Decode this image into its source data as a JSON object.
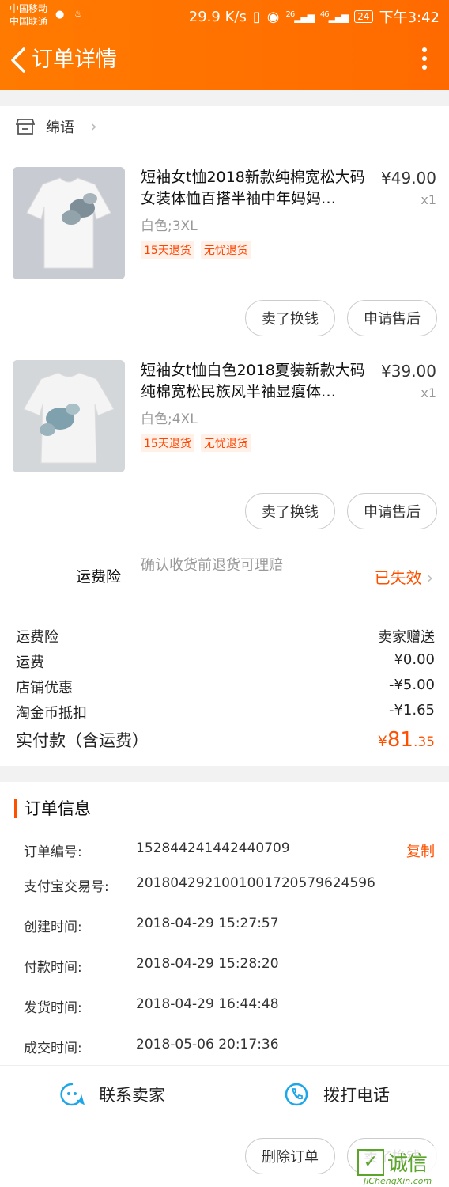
{
  "status_bar": {
    "carrier1": "中国移动",
    "carrier2": "中国联通",
    "speed": "29.9 K/s",
    "signal1": "26",
    "signal2": "46",
    "battery": "24",
    "time": "下午3:42"
  },
  "header": {
    "title": "订单详情"
  },
  "shop": {
    "name": "绵语"
  },
  "items": [
    {
      "title": "短袖女t恤2018新款纯棉宽松大码女装体恤百搭半袖中年妈妈…",
      "price": "¥49.00",
      "qty": "x1",
      "spec": "白色;3XL",
      "tag1": "15天退货",
      "tag2": "无忧退货",
      "btn_sell": "卖了换钱",
      "btn_after_sale": "申请售后"
    },
    {
      "title": "短袖女t恤白色2018夏装新款大码纯棉宽松民族风半袖显瘦体…",
      "price": "¥39.00",
      "qty": "x1",
      "spec": "白色;4XL",
      "tag1": "15天退货",
      "tag2": "无忧退货",
      "btn_sell": "卖了换钱",
      "btn_after_sale": "申请售后"
    }
  ],
  "insurance": {
    "label": "运费险",
    "desc": "确认收货前退货可理赔",
    "status": "已失效"
  },
  "fees": [
    {
      "label": "运费险",
      "value": "卖家赠送"
    },
    {
      "label": "运费",
      "value": "¥0.00"
    },
    {
      "label": "店铺优惠",
      "value": "-¥5.00"
    },
    {
      "label": "淘金币抵扣",
      "value": "-¥1.65"
    }
  ],
  "paid": {
    "label": "实付款（含运费）",
    "currency": "¥",
    "integer": "81",
    "decimal": ".35"
  },
  "order_info": {
    "title": "订单信息",
    "rows": [
      {
        "label": "订单编号:",
        "value": "152844241442440709"
      },
      {
        "label": "支付宝交易号:",
        "value": "2018042921001001720579624596"
      },
      {
        "label": "创建时间:",
        "value": "2018-04-29 15:27:57"
      },
      {
        "label": "付款时间:",
        "value": "2018-04-29 15:28:20"
      },
      {
        "label": "发货时间:",
        "value": "2018-04-29 16:44:48"
      },
      {
        "label": "成交时间:",
        "value": "2018-05-06 20:17:36"
      }
    ],
    "copy_label": "复制"
  },
  "contact": {
    "seller": "联系卖家",
    "phone": "拨打电话"
  },
  "bottom_bar": {
    "delete": "删除订单",
    "sell": "卖了换钱"
  },
  "watermark": {
    "text": "诚信",
    "sub": "JiChengXin.com"
  },
  "colors": {
    "accent": "#ff5000",
    "header": "#ff7a00"
  }
}
